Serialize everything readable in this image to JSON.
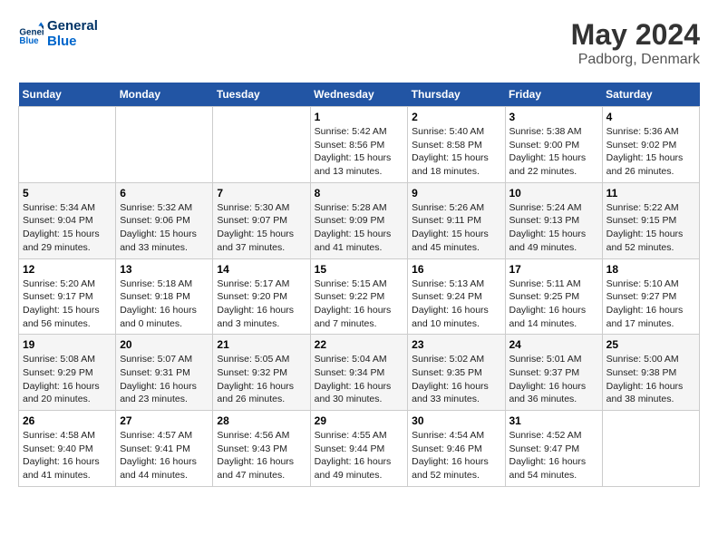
{
  "logo": {
    "line1": "General",
    "line2": "Blue"
  },
  "header": {
    "month": "May 2024",
    "location": "Padborg, Denmark"
  },
  "weekdays": [
    "Sunday",
    "Monday",
    "Tuesday",
    "Wednesday",
    "Thursday",
    "Friday",
    "Saturday"
  ],
  "weeks": [
    [
      {
        "day": "",
        "info": ""
      },
      {
        "day": "",
        "info": ""
      },
      {
        "day": "",
        "info": ""
      },
      {
        "day": "1",
        "info": "Sunrise: 5:42 AM\nSunset: 8:56 PM\nDaylight: 15 hours\nand 13 minutes."
      },
      {
        "day": "2",
        "info": "Sunrise: 5:40 AM\nSunset: 8:58 PM\nDaylight: 15 hours\nand 18 minutes."
      },
      {
        "day": "3",
        "info": "Sunrise: 5:38 AM\nSunset: 9:00 PM\nDaylight: 15 hours\nand 22 minutes."
      },
      {
        "day": "4",
        "info": "Sunrise: 5:36 AM\nSunset: 9:02 PM\nDaylight: 15 hours\nand 26 minutes."
      }
    ],
    [
      {
        "day": "5",
        "info": "Sunrise: 5:34 AM\nSunset: 9:04 PM\nDaylight: 15 hours\nand 29 minutes."
      },
      {
        "day": "6",
        "info": "Sunrise: 5:32 AM\nSunset: 9:06 PM\nDaylight: 15 hours\nand 33 minutes."
      },
      {
        "day": "7",
        "info": "Sunrise: 5:30 AM\nSunset: 9:07 PM\nDaylight: 15 hours\nand 37 minutes."
      },
      {
        "day": "8",
        "info": "Sunrise: 5:28 AM\nSunset: 9:09 PM\nDaylight: 15 hours\nand 41 minutes."
      },
      {
        "day": "9",
        "info": "Sunrise: 5:26 AM\nSunset: 9:11 PM\nDaylight: 15 hours\nand 45 minutes."
      },
      {
        "day": "10",
        "info": "Sunrise: 5:24 AM\nSunset: 9:13 PM\nDaylight: 15 hours\nand 49 minutes."
      },
      {
        "day": "11",
        "info": "Sunrise: 5:22 AM\nSunset: 9:15 PM\nDaylight: 15 hours\nand 52 minutes."
      }
    ],
    [
      {
        "day": "12",
        "info": "Sunrise: 5:20 AM\nSunset: 9:17 PM\nDaylight: 15 hours\nand 56 minutes."
      },
      {
        "day": "13",
        "info": "Sunrise: 5:18 AM\nSunset: 9:18 PM\nDaylight: 16 hours\nand 0 minutes."
      },
      {
        "day": "14",
        "info": "Sunrise: 5:17 AM\nSunset: 9:20 PM\nDaylight: 16 hours\nand 3 minutes."
      },
      {
        "day": "15",
        "info": "Sunrise: 5:15 AM\nSunset: 9:22 PM\nDaylight: 16 hours\nand 7 minutes."
      },
      {
        "day": "16",
        "info": "Sunrise: 5:13 AM\nSunset: 9:24 PM\nDaylight: 16 hours\nand 10 minutes."
      },
      {
        "day": "17",
        "info": "Sunrise: 5:11 AM\nSunset: 9:25 PM\nDaylight: 16 hours\nand 14 minutes."
      },
      {
        "day": "18",
        "info": "Sunrise: 5:10 AM\nSunset: 9:27 PM\nDaylight: 16 hours\nand 17 minutes."
      }
    ],
    [
      {
        "day": "19",
        "info": "Sunrise: 5:08 AM\nSunset: 9:29 PM\nDaylight: 16 hours\nand 20 minutes."
      },
      {
        "day": "20",
        "info": "Sunrise: 5:07 AM\nSunset: 9:31 PM\nDaylight: 16 hours\nand 23 minutes."
      },
      {
        "day": "21",
        "info": "Sunrise: 5:05 AM\nSunset: 9:32 PM\nDaylight: 16 hours\nand 26 minutes."
      },
      {
        "day": "22",
        "info": "Sunrise: 5:04 AM\nSunset: 9:34 PM\nDaylight: 16 hours\nand 30 minutes."
      },
      {
        "day": "23",
        "info": "Sunrise: 5:02 AM\nSunset: 9:35 PM\nDaylight: 16 hours\nand 33 minutes."
      },
      {
        "day": "24",
        "info": "Sunrise: 5:01 AM\nSunset: 9:37 PM\nDaylight: 16 hours\nand 36 minutes."
      },
      {
        "day": "25",
        "info": "Sunrise: 5:00 AM\nSunset: 9:38 PM\nDaylight: 16 hours\nand 38 minutes."
      }
    ],
    [
      {
        "day": "26",
        "info": "Sunrise: 4:58 AM\nSunset: 9:40 PM\nDaylight: 16 hours\nand 41 minutes."
      },
      {
        "day": "27",
        "info": "Sunrise: 4:57 AM\nSunset: 9:41 PM\nDaylight: 16 hours\nand 44 minutes."
      },
      {
        "day": "28",
        "info": "Sunrise: 4:56 AM\nSunset: 9:43 PM\nDaylight: 16 hours\nand 47 minutes."
      },
      {
        "day": "29",
        "info": "Sunrise: 4:55 AM\nSunset: 9:44 PM\nDaylight: 16 hours\nand 49 minutes."
      },
      {
        "day": "30",
        "info": "Sunrise: 4:54 AM\nSunset: 9:46 PM\nDaylight: 16 hours\nand 52 minutes."
      },
      {
        "day": "31",
        "info": "Sunrise: 4:52 AM\nSunset: 9:47 PM\nDaylight: 16 hours\nand 54 minutes."
      },
      {
        "day": "",
        "info": ""
      }
    ]
  ]
}
